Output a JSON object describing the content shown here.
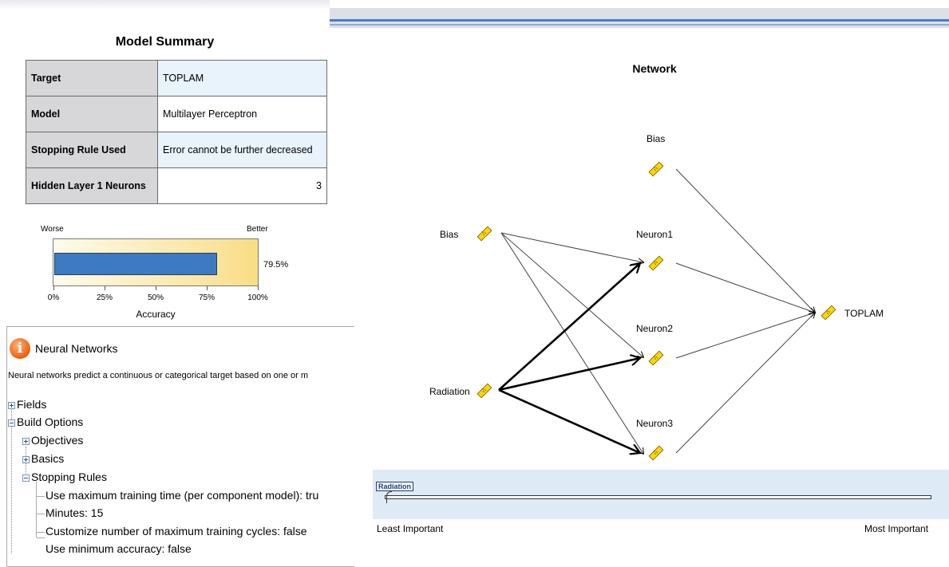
{
  "model_summary": {
    "title": "Model Summary",
    "rows": [
      {
        "key": "Target",
        "value": "TOPLAM"
      },
      {
        "key": "Model",
        "value": "Multilayer Perceptron"
      },
      {
        "key": "Stopping Rule Used",
        "value": "Error cannot be further decreased"
      },
      {
        "key": "Hidden Layer 1 Neurons",
        "value": "3"
      }
    ]
  },
  "accuracy": {
    "worse_label": "Worse",
    "better_label": "Better",
    "value": 0.795,
    "value_label": "79.5%",
    "axis_label": "Accuracy",
    "ticks": [
      "0%",
      "25%",
      "50%",
      "75%",
      "100%"
    ],
    "bar_color": "#3d7ac3"
  },
  "neural_networks": {
    "title": "Neural Networks",
    "icon": "info-icon",
    "description": "Neural networks predict a continuous or categorical target based on one or m",
    "tree": [
      {
        "label": "Fields",
        "state": "collapsed"
      },
      {
        "label": "Build Options",
        "state": "expanded"
      },
      {
        "label": "Objectives",
        "state": "collapsed"
      },
      {
        "label": "Basics",
        "state": "collapsed"
      },
      {
        "label": "Stopping Rules",
        "state": "expanded"
      },
      {
        "label": "Use maximum training time (per component model): tru"
      },
      {
        "label": "Minutes: 15"
      },
      {
        "label": "Customize number of maximum training cycles: false"
      },
      {
        "label": "Use minimum accuracy: false"
      }
    ]
  },
  "network": {
    "title": "Network",
    "input_bias": "Bias",
    "input_radiation": "Radiation",
    "hidden_bias": "Bias",
    "neurons": [
      "Neuron1",
      "Neuron2",
      "Neuron3"
    ],
    "output": "TOPLAM",
    "icon": "ruler-icon"
  },
  "importance": {
    "tag": "Radiation",
    "least_label": "Least Important",
    "most_label": "Most Important"
  },
  "colors": {
    "accent": "#3d7ac3",
    "header_blue": "#4a7dc4",
    "importance_bg": "#deebf7"
  }
}
